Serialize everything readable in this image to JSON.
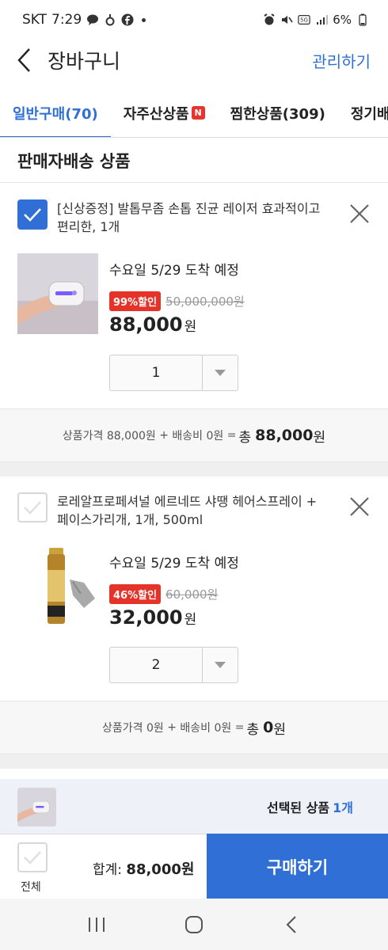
{
  "status_bar": {
    "carrier": "SKT",
    "time": "7:29",
    "battery": "6%"
  },
  "header": {
    "title": "장바구니",
    "manage": "관리하기"
  },
  "tabs": [
    {
      "label": "일반구매(70)",
      "active": true
    },
    {
      "label": "자주산상품",
      "badge": "N"
    },
    {
      "label": "찜한상품(309)"
    },
    {
      "label": "정기배송"
    }
  ],
  "section_title": "판매자배송 상품",
  "items": [
    {
      "checked": true,
      "name": "[신상증정] 발톱무좀 손톱 진균 레이저 효과적이고 편리한, 1개",
      "delivery": "수요일 5/29 도착 예정",
      "discount": "99%할인",
      "original_price": "50,000,000원",
      "price": "88,000",
      "won": "원",
      "quantity": "1",
      "summary": {
        "price_label": "상품가격",
        "price_value": "88,000원",
        "plus": "+",
        "shipping_label": "배송비",
        "shipping_value": "0원",
        "equals": "=",
        "total_label": "총",
        "total_value": "88,000",
        "total_won": "원"
      }
    },
    {
      "checked": false,
      "name": "로레알프로페셔널 에르네뜨 샤땡 헤어스프레이 + 페이스가리개, 1개, 500ml",
      "delivery": "수요일 5/29 도착 예정",
      "discount": "46%할인",
      "original_price": "60,000원",
      "price": "32,000",
      "won": "원",
      "quantity": "2",
      "summary": {
        "price_label": "상품가격",
        "price_value": "0원",
        "plus": "+",
        "shipping_label": "배송비",
        "shipping_value": "0원",
        "equals": "=",
        "total_label": "총",
        "total_value": "0",
        "total_won": "원"
      }
    }
  ],
  "selected": {
    "label": "선택된 상품",
    "count": "1개"
  },
  "bottom": {
    "all_label": "전체",
    "sum_label": "합계:",
    "sum_value": "88,000원",
    "buy": "구매하기"
  },
  "colors": {
    "accent": "#2f6fd6",
    "discount": "#e5332a"
  }
}
